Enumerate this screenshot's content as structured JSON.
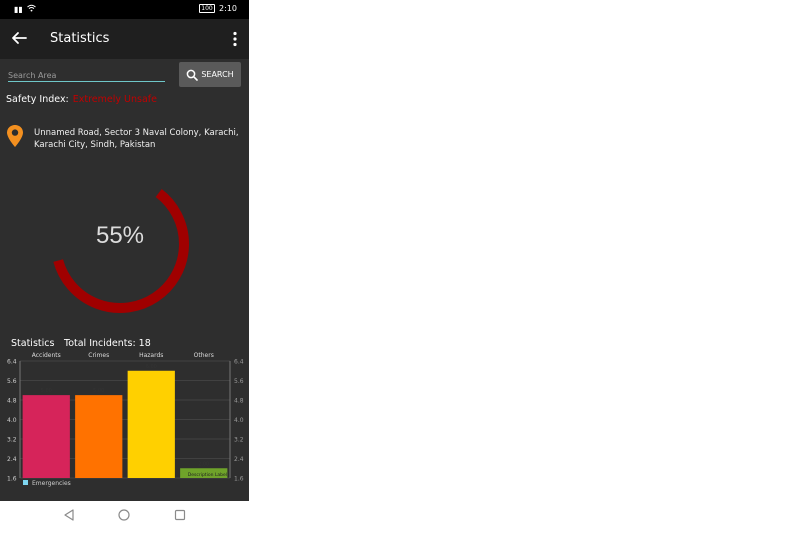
{
  "status_bar": {
    "left_text": "⁴⁶",
    "battery": "100",
    "time": "2:10"
  },
  "app_bar": {
    "title": "Statistics"
  },
  "search": {
    "placeholder": "Search Area",
    "button_label": "SEARCH"
  },
  "safety": {
    "label": "Safety Index:",
    "value": "Extremely Unsafe"
  },
  "location": {
    "address": "Unnamed Road, Sector 3 Naval Colony, Karachi, Karachi City, Sindh, Pakistan"
  },
  "gauge": {
    "percent_text": "55%",
    "percent": 55,
    "color": "#a00000"
  },
  "stats": {
    "title": "Statistics",
    "total": "Total Incidents: 18"
  },
  "chart_data": {
    "type": "bar",
    "categories": [
      "Accidents",
      "Crimes",
      "Hazards",
      "Others"
    ],
    "series": [
      {
        "name": "Emergencies",
        "values": [
          5.0,
          5.0,
          6.0,
          2.0
        ]
      }
    ],
    "value_labels": [
      "5.00",
      "5.00",
      "6.00",
      "2.00"
    ],
    "colors": [
      "#d6245a",
      "#ff7200",
      "#ffd000",
      "#6fa32a"
    ],
    "ylim": [
      1.6,
      6.4
    ],
    "yticks": [
      "6.4",
      "5.6",
      "4.8",
      "4.0",
      "3.2",
      "2.4",
      "1.6"
    ],
    "yticks_right": [
      "6.4",
      "5.6",
      "4.8",
      "4.0",
      "3.2",
      "2.4",
      "1.6"
    ],
    "description_label": "Description Label",
    "legend": "bottom-left",
    "grid": true
  }
}
